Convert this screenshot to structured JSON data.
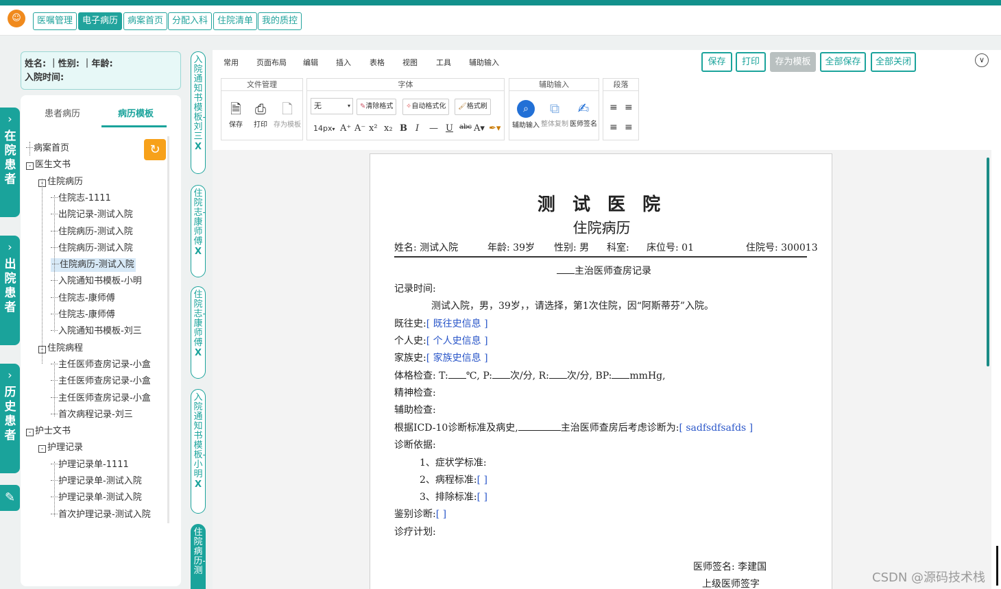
{
  "top_nav": {
    "logo_text": "",
    "buttons": [
      "医嘱管理",
      "电子病历",
      "病案首页",
      "分配入科",
      "住院清单",
      "我的质控"
    ],
    "active_index": 1
  },
  "left_tabs": [
    {
      "label": "在院患者"
    },
    {
      "label": "出院患者"
    },
    {
      "label": "历史患者"
    }
  ],
  "patient": {
    "line1": "姓名: ｜性别: ｜年龄:",
    "line2": "入院时间:"
  },
  "tree_tabs": [
    "患者病历",
    "病历模板"
  ],
  "tree": [
    {
      "label": "病案首页",
      "level": 0,
      "expander": ""
    },
    {
      "label": "医生文书",
      "level": 0,
      "expander": "-"
    },
    {
      "label": "住院病历",
      "level": 1,
      "expander": "-"
    },
    {
      "label": "住院志-1111",
      "level": 2,
      "expander": ""
    },
    {
      "label": "出院记录-测试入院",
      "level": 2,
      "expander": ""
    },
    {
      "label": "住院病历-测试入院",
      "level": 2,
      "expander": ""
    },
    {
      "label": "住院病历-测试入院",
      "level": 2,
      "expander": ""
    },
    {
      "label": "住院病历-测试入院",
      "level": 2,
      "expander": "",
      "selected": true
    },
    {
      "label": "入院通知书模板-小明",
      "level": 2,
      "expander": ""
    },
    {
      "label": "住院志-康师傅",
      "level": 2,
      "expander": ""
    },
    {
      "label": "住院志-康师傅",
      "level": 2,
      "expander": ""
    },
    {
      "label": "入院通知书模板-刘三",
      "level": 2,
      "expander": ""
    },
    {
      "label": "住院病程",
      "level": 1,
      "expander": "-"
    },
    {
      "label": "主任医师查房记录-小盒",
      "level": 2,
      "expander": ""
    },
    {
      "label": "主任医师查房记录-小盒",
      "level": 2,
      "expander": ""
    },
    {
      "label": "主任医师查房记录-小盒",
      "level": 2,
      "expander": ""
    },
    {
      "label": "首次病程记录-刘三",
      "level": 2,
      "expander": ""
    },
    {
      "label": "护士文书",
      "level": 0,
      "expander": "-"
    },
    {
      "label": "护理记录",
      "level": 1,
      "expander": "-"
    },
    {
      "label": "护理记录单-1111",
      "level": 2,
      "expander": ""
    },
    {
      "label": "护理记录单-测试入院",
      "level": 2,
      "expander": ""
    },
    {
      "label": "护理记录单-测试入院",
      "level": 2,
      "expander": ""
    },
    {
      "label": "首次护理记录-测试入院",
      "level": 2,
      "expander": ""
    }
  ],
  "doc_tabs": [
    {
      "label": "入院通知书模板-刘三",
      "close": "X"
    },
    {
      "label": "住院志-康师傅",
      "close": "X"
    },
    {
      "label": "住院志-康师傅",
      "close": "X"
    },
    {
      "label": "入院通知书模板-小明",
      "close": "X"
    },
    {
      "label": "住院病历-测",
      "close": ""
    }
  ],
  "editor": {
    "menu_tabs": [
      "常用",
      "页面布局",
      "编辑",
      "插入",
      "表格",
      "视图",
      "工具",
      "辅助输入"
    ],
    "actions": [
      {
        "label": "保存",
        "disabled": false
      },
      {
        "label": "打印",
        "disabled": false
      },
      {
        "label": "存为模板",
        "disabled": true
      },
      {
        "label": "全部保存",
        "disabled": false
      },
      {
        "label": "全部关闭",
        "disabled": false
      }
    ],
    "groups": {
      "file": {
        "title": "文件管理",
        "tools": [
          "保存",
          "打印",
          "存为模板"
        ]
      },
      "font": {
        "title": "字体",
        "font_value": "无",
        "size_value": "14px",
        "buttons": [
          "清除格式",
          "自动格式化",
          "格式刷"
        ]
      },
      "assist": {
        "title": "辅助输入",
        "tools": [
          "辅助输入",
          "整体复制",
          "医师签名"
        ]
      },
      "para": {
        "title": "段落"
      }
    }
  },
  "document": {
    "hospital": "测 试 医 院",
    "title": "住院病历",
    "header": {
      "name": "姓名: 测试入院",
      "age": "年龄: 39岁",
      "sex": "性别: 男",
      "dept": "科室:",
      "bed": "床位号: 01",
      "admission_no": "住院号: 300013"
    },
    "subtitle": "主治医师查房记录",
    "record_time": "记录时间:",
    "summary": "测试入院，男，39岁，，请选择，第1次住院，因“阿斯蒂芬”入院。",
    "past_history_label": "既往史:",
    "past_history_value": "[ 既往史信息 ]",
    "personal_history_label": "个人史:",
    "personal_history_value": "[ 个人史信息 ]",
    "family_history_label": "家族史:",
    "family_history_value": "[ 家族史信息 ]",
    "physical_exam": {
      "label": "体格检查:",
      "t": "T:",
      "t_unit": "℃,",
      "p": "P:",
      "p_unit": "次/分,",
      "r": "R:",
      "r_unit": "次/分,",
      "bp": "BP:",
      "bp_unit": "mmHg,"
    },
    "mental_exam": "精神检查:",
    "aux_exam": "辅助检查:",
    "diagnosis_line_prefix": "根据ICD-10诊断标准及病史,",
    "diagnosis_line_mid": "主治医师查房后考虑诊断为:",
    "diagnosis_line_value": "[ sadfsdfsafds ]",
    "diagnosis_basis": "诊断依据:",
    "basis_items": [
      {
        "label": "1、症状学标准:",
        "value": ""
      },
      {
        "label": "2、病程标准:",
        "value": "[ ]"
      },
      {
        "label": "3、排除标准:",
        "value": "[ ]"
      }
    ],
    "differential_label": "鉴别诊断:",
    "differential_value": "[ ]",
    "treatment_plan": "诊疗计划:",
    "signature": "医师签名: 李建国",
    "superior_signature": "上级医师签字"
  },
  "watermark": "CSDN @源码技术栈"
}
